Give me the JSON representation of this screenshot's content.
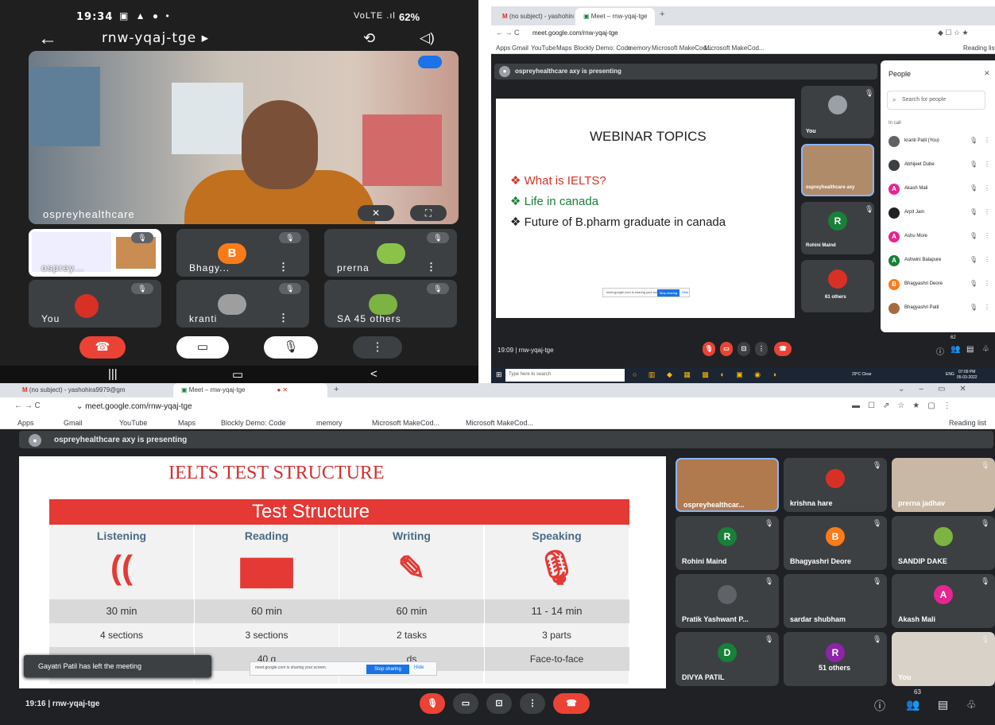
{
  "phone": {
    "status_time": "19:34",
    "status_battery": "62%",
    "status_signal": "VoLTE .ıl",
    "status_sys_icons": "▣ ▲ ● •",
    "meeting_code": "rnw-yqaj-tge ▸",
    "main_speaker": "ospreyhealthcare",
    "tiles": [
      {
        "name": "osprey...",
        "avatar": ""
      },
      {
        "name": "Bhagy...",
        "avatar": "B"
      },
      {
        "name": "prerna",
        "avatar": ""
      },
      {
        "name": "You",
        "avatar": ""
      },
      {
        "name": "kranti",
        "avatar": ""
      },
      {
        "name": "SA 45 others",
        "avatar": ""
      }
    ],
    "overlay_others": "45 others"
  },
  "desk1": {
    "tabs": [
      {
        "label": "(no subject) - yashohira9979@g"
      },
      {
        "label": "Meet – rnw-yqaj-tge"
      }
    ],
    "url": "meet.google.com/rnw-yqaj-tge",
    "bookmarks": [
      "Apps",
      "Gmail",
      "YouTube",
      "Maps",
      "Blockly Demo: Code",
      "memory",
      "Microsoft MakeCod...",
      "Microsoft MakeCod..."
    ],
    "reading_list": "Reading list",
    "presenting_banner": "ospreyhealthcare axy is presenting",
    "slide": {
      "title": "WEBINAR TOPICS",
      "bullets": [
        {
          "text": "What is IELTS?",
          "color": "#d93025"
        },
        {
          "text": "Life in canada",
          "color": "#188038"
        },
        {
          "text": "Future of  B.pharm graduate in canada",
          "color": "#202124"
        }
      ],
      "share_note": "meet.google.com is sharing your screen.",
      "stop_label": "Stop sharing",
      "hide_label": "Hide"
    },
    "tiles": [
      {
        "name": "You"
      },
      {
        "name": "ospreyhealthcare axy"
      },
      {
        "name": "Rohini Maind",
        "avatar": "R"
      },
      {
        "name": "61 others"
      }
    ],
    "time_code": "19:09  |  rnw-yqaj-tge",
    "people_panel": {
      "title": "People",
      "search_placeholder": "Search for people",
      "section": "In call",
      "people": [
        {
          "name": "kranti Patil (You)",
          "avatar": "",
          "color": "#5f6368"
        },
        {
          "name": "Abhijeet Dube",
          "avatar": "",
          "color": "#3c4043"
        },
        {
          "name": "Akash Mali",
          "avatar": "A",
          "color": "#e52592"
        },
        {
          "name": "Arpit Jain",
          "avatar": "",
          "color": "#202124"
        },
        {
          "name": "Ashu More",
          "avatar": "A",
          "color": "#e52592"
        },
        {
          "name": "Ashwini Balapure",
          "avatar": "A",
          "color": "#188038"
        },
        {
          "name": "Bhagyashri Deore",
          "avatar": "B",
          "color": "#fa7b17"
        },
        {
          "name": "Bhagyashri Patil",
          "avatar": "",
          "color": "#a56b3f"
        }
      ]
    },
    "people_count": "62",
    "taskbar": {
      "search": "Type here to search",
      "weather": "29°C  Clear",
      "time": "07:09 PM",
      "date": "05-03-2022",
      "lang": "ENG"
    }
  },
  "desk2": {
    "tabs": [
      {
        "label": "(no subject) - yashohira9979@gm"
      },
      {
        "label": "Meet – rnw-yqaj-tge"
      }
    ],
    "url": "meet.google.com/rnw-yqaj-tge",
    "bookmarks": [
      "Apps",
      "Gmail",
      "YouTube",
      "Maps",
      "Blockly Demo: Code",
      "memory",
      "Microsoft MakeCod...",
      "Microsoft MakeCod..."
    ],
    "reading_list": "Reading list",
    "presenting_banner": "ospreyhealthcare axy is presenting",
    "slide": {
      "title": "IELTS TEST STRUCTURE",
      "table_header": "Test Structure",
      "columns": [
        {
          "name": "Listening",
          "icon": "ear-icon",
          "time": "30 min",
          "units": "4 sections",
          "mode": ""
        },
        {
          "name": "Reading",
          "icon": "book-icon",
          "time": "60 min",
          "units": "3 sections",
          "mode": "40 q"
        },
        {
          "name": "Writing",
          "icon": "pencil-icon",
          "time": "60 min",
          "units": "2 tasks",
          "mode": "ds"
        },
        {
          "name": "Speaking",
          "icon": "microphone-icon",
          "time": "11 - 14 min",
          "units": "3 parts",
          "mode": "Face-to-face"
        }
      ],
      "share_note": "meet.google.com is sharing your screen.",
      "stop_label": "Stop sharing",
      "hide_label": "Hide"
    },
    "toast": "Gayatri Patil has left the meeting",
    "tiles": [
      {
        "name": "ospreyhealthcar...",
        "avatar": ""
      },
      {
        "name": "krishna hare",
        "avatar": ""
      },
      {
        "name": "prerna jadhav",
        "avatar": ""
      },
      {
        "name": "Rohini Maind",
        "avatar": "R"
      },
      {
        "name": "Bhagyashri Deore",
        "avatar": "B"
      },
      {
        "name": "SANDIP DAKE",
        "avatar": ""
      },
      {
        "name": "Pratik Yashwant P...",
        "avatar": ""
      },
      {
        "name": "sardar shubham",
        "avatar": ""
      },
      {
        "name": "Akash Mali",
        "avatar": "A"
      },
      {
        "name": "DIVYA PATIL",
        "avatar": "D"
      },
      {
        "name": "51 others",
        "avatar": "R"
      },
      {
        "name": "You",
        "avatar": ""
      }
    ],
    "time_code": "19:16  |  rnw-yqaj-tge",
    "people_count": "63"
  },
  "colors": {
    "meet_bg": "#202124",
    "tile_bg": "#3c4043",
    "end_red": "#ea4335",
    "accent_blue": "#1a73e8",
    "slide_red": "#e53935"
  }
}
